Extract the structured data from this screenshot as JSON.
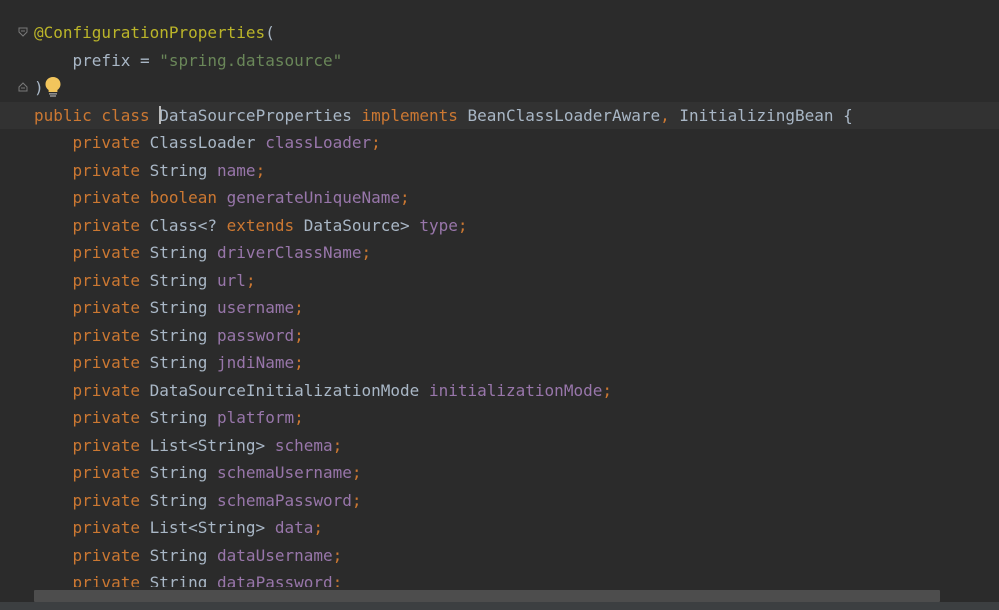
{
  "editor": {
    "lines": [
      {
        "segments": [
          {
            "t": "@ConfigurationProperties",
            "c": "ann"
          },
          {
            "t": "(",
            "c": "typ"
          }
        ],
        "fold": true
      },
      {
        "segments": [
          {
            "t": "    prefix = ",
            "c": "typ"
          },
          {
            "t": "\"spring.datasource\"",
            "c": "str"
          }
        ]
      },
      {
        "segments": [
          {
            "t": ")",
            "c": "typ"
          }
        ],
        "fold": true,
        "bulb": true
      },
      {
        "segments": [
          {
            "t": "public class ",
            "c": "kw"
          },
          {
            "t": "CARET",
            "c": "caret"
          },
          {
            "t": "DataSourceProperties",
            "c": "typ"
          },
          {
            "t": " implements ",
            "c": "kw"
          },
          {
            "t": "BeanClassLoaderAware",
            "c": "typ"
          },
          {
            "t": ", ",
            "c": "punc"
          },
          {
            "t": "InitializingBean {",
            "c": "typ"
          }
        ],
        "current": true
      },
      {
        "segments": [
          {
            "t": "    private ",
            "c": "kw"
          },
          {
            "t": "ClassLoader ",
            "c": "typ"
          },
          {
            "t": "classLoader",
            "c": "fld"
          },
          {
            "t": ";",
            "c": "punc"
          }
        ]
      },
      {
        "segments": [
          {
            "t": "    private ",
            "c": "kw"
          },
          {
            "t": "String ",
            "c": "typ"
          },
          {
            "t": "name",
            "c": "fld"
          },
          {
            "t": ";",
            "c": "punc"
          }
        ]
      },
      {
        "segments": [
          {
            "t": "    private boolean ",
            "c": "kw"
          },
          {
            "t": "generateUniqueName",
            "c": "fld"
          },
          {
            "t": ";",
            "c": "punc"
          }
        ]
      },
      {
        "segments": [
          {
            "t": "    private ",
            "c": "kw"
          },
          {
            "t": "Class<? ",
            "c": "typ"
          },
          {
            "t": "extends ",
            "c": "kw"
          },
          {
            "t": "DataSource> ",
            "c": "typ"
          },
          {
            "t": "type",
            "c": "fld"
          },
          {
            "t": ";",
            "c": "punc"
          }
        ]
      },
      {
        "segments": [
          {
            "t": "    private ",
            "c": "kw"
          },
          {
            "t": "String ",
            "c": "typ"
          },
          {
            "t": "driverClassName",
            "c": "fld"
          },
          {
            "t": ";",
            "c": "punc"
          }
        ]
      },
      {
        "segments": [
          {
            "t": "    private ",
            "c": "kw"
          },
          {
            "t": "String ",
            "c": "typ"
          },
          {
            "t": "url",
            "c": "fld"
          },
          {
            "t": ";",
            "c": "punc"
          }
        ]
      },
      {
        "segments": [
          {
            "t": "    private ",
            "c": "kw"
          },
          {
            "t": "String ",
            "c": "typ"
          },
          {
            "t": "username",
            "c": "fld"
          },
          {
            "t": ";",
            "c": "punc"
          }
        ]
      },
      {
        "segments": [
          {
            "t": "    private ",
            "c": "kw"
          },
          {
            "t": "String ",
            "c": "typ"
          },
          {
            "t": "password",
            "c": "fld"
          },
          {
            "t": ";",
            "c": "punc"
          }
        ]
      },
      {
        "segments": [
          {
            "t": "    private ",
            "c": "kw"
          },
          {
            "t": "String ",
            "c": "typ"
          },
          {
            "t": "jndiName",
            "c": "fld"
          },
          {
            "t": ";",
            "c": "punc"
          }
        ]
      },
      {
        "segments": [
          {
            "t": "    private ",
            "c": "kw"
          },
          {
            "t": "DataSourceInitializationMode ",
            "c": "typ"
          },
          {
            "t": "initializationMode",
            "c": "fld"
          },
          {
            "t": ";",
            "c": "punc"
          }
        ]
      },
      {
        "segments": [
          {
            "t": "    private ",
            "c": "kw"
          },
          {
            "t": "String ",
            "c": "typ"
          },
          {
            "t": "platform",
            "c": "fld"
          },
          {
            "t": ";",
            "c": "punc"
          }
        ]
      },
      {
        "segments": [
          {
            "t": "    private ",
            "c": "kw"
          },
          {
            "t": "List<String> ",
            "c": "typ"
          },
          {
            "t": "schema",
            "c": "fld"
          },
          {
            "t": ";",
            "c": "punc"
          }
        ]
      },
      {
        "segments": [
          {
            "t": "    private ",
            "c": "kw"
          },
          {
            "t": "String ",
            "c": "typ"
          },
          {
            "t": "schemaUsername",
            "c": "fld"
          },
          {
            "t": ";",
            "c": "punc"
          }
        ]
      },
      {
        "segments": [
          {
            "t": "    private ",
            "c": "kw"
          },
          {
            "t": "String ",
            "c": "typ"
          },
          {
            "t": "schemaPassword",
            "c": "fld"
          },
          {
            "t": ";",
            "c": "punc"
          }
        ]
      },
      {
        "segments": [
          {
            "t": "    private ",
            "c": "kw"
          },
          {
            "t": "List<String> ",
            "c": "typ"
          },
          {
            "t": "data",
            "c": "fld"
          },
          {
            "t": ";",
            "c": "punc"
          }
        ]
      },
      {
        "segments": [
          {
            "t": "    private ",
            "c": "kw"
          },
          {
            "t": "String ",
            "c": "typ"
          },
          {
            "t": "dataUsername",
            "c": "fld"
          },
          {
            "t": ";",
            "c": "punc"
          }
        ]
      },
      {
        "segments": [
          {
            "t": "    private ",
            "c": "kw"
          },
          {
            "t": "String ",
            "c": "typ"
          },
          {
            "t": "dataPassword",
            "c": "fld"
          },
          {
            "t": ";",
            "c": "punc"
          }
        ]
      }
    ]
  },
  "icons": {
    "fold": "fold-marker-icon",
    "bulb": "lightbulb-icon"
  },
  "colors": {
    "background": "#2b2b2b",
    "keyword": "#cc7832",
    "annotation": "#bbb529",
    "string": "#6a8759",
    "field": "#9876aa",
    "text": "#a9b7c6",
    "bulb": "#f2c55c"
  }
}
